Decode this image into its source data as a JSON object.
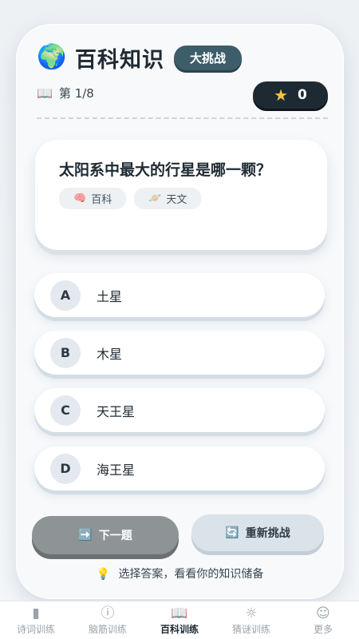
{
  "header": {
    "icon": "globe-icon",
    "title": "百科知识",
    "badge": "大挑战"
  },
  "progress": {
    "icon": "book-icon",
    "label": "第 1/8"
  },
  "score": {
    "icon": "star-icon",
    "value": "0"
  },
  "question": {
    "text": "太阳系中最大的行星是哪一颗？",
    "tags": [
      {
        "icon": "brain-icon",
        "label": "百科"
      },
      {
        "icon": "planet-icon",
        "label": "天文"
      }
    ]
  },
  "options": [
    {
      "letter": "A",
      "text": "土星"
    },
    {
      "letter": "B",
      "text": "木星"
    },
    {
      "letter": "C",
      "text": "天王星"
    },
    {
      "letter": "D",
      "text": "海王星"
    }
  ],
  "actions": {
    "next_label": "下一题",
    "restart_label": "重新挑战"
  },
  "hint": {
    "icon": "bulb-icon",
    "text": "选择答案，看看你的知识储备"
  },
  "tabbar": {
    "items": [
      {
        "icon": "poem-book-icon",
        "label": "诗词训练",
        "active": false
      },
      {
        "icon": "question-circle-icon",
        "label": "脑筋训练",
        "active": false
      },
      {
        "icon": "open-book-icon",
        "label": "百科训练",
        "active": true
      },
      {
        "icon": "lightbulb-icon",
        "label": "猜谜训练",
        "active": false
      },
      {
        "icon": "user-icon",
        "label": "更多",
        "active": false
      }
    ]
  },
  "colors": {
    "badge_bg": "#3e5d6b",
    "score_bg": "#1e2a33",
    "star": "#f6c343",
    "next_button_bg": "#8e9396",
    "restart_button_bg": "#dbe3ea"
  }
}
